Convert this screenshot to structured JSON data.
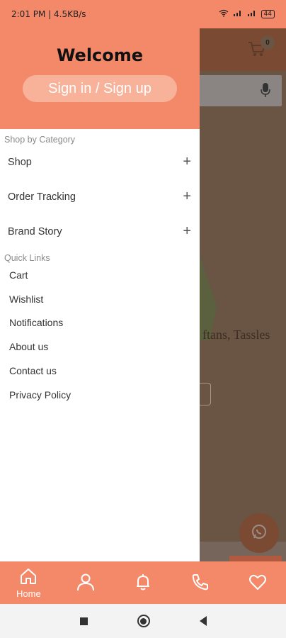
{
  "status_bar": {
    "time_speed": "2:01 PM | 4.5KB/s",
    "battery": "44"
  },
  "background_app": {
    "cart_count": "0",
    "visible_text": "ftans, Tassles"
  },
  "drawer": {
    "welcome": "Welcome",
    "signin_button": "Sign in / Sign up",
    "shop_by_category_label": "Shop by Category",
    "categories": [
      {
        "label": "Shop"
      },
      {
        "label": "Order Tracking"
      },
      {
        "label": "Brand Story"
      }
    ],
    "quick_links_label": "Quick Links",
    "quick_links": [
      {
        "label": "Cart"
      },
      {
        "label": "Wishlist"
      },
      {
        "label": "Notifications"
      },
      {
        "label": "About us"
      },
      {
        "label": "Contact us"
      },
      {
        "label": "Privacy Policy"
      }
    ]
  },
  "bottom_nav": {
    "home_label": "Home",
    "items": [
      "home-icon",
      "account-icon",
      "bell-icon",
      "phone-icon",
      "heart-icon"
    ]
  },
  "colors": {
    "accent": "#f4896a",
    "signin_bg": "#f8b29a"
  }
}
